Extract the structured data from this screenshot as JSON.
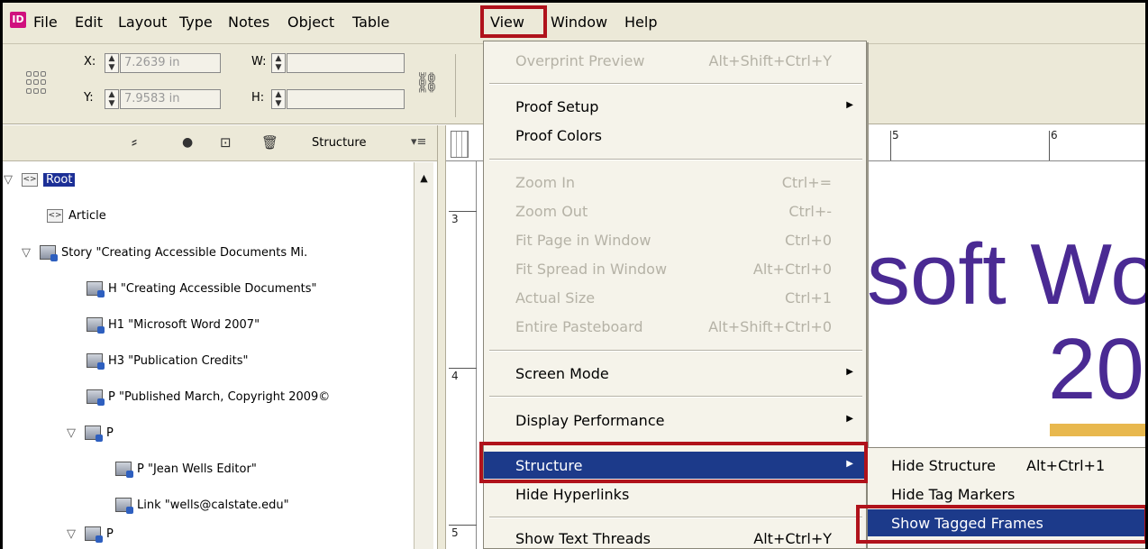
{
  "menubar": {
    "app_icon": "ID",
    "items": [
      "File",
      "Edit",
      "Layout",
      "Type",
      "Notes",
      "Object",
      "Table",
      "View",
      "Window",
      "Help"
    ]
  },
  "control": {
    "x_label": "X:",
    "x_value": "7.2639 in",
    "y_label": "Y:",
    "y_value": "7.9583 in",
    "w_label": "W:",
    "h_label": "H:"
  },
  "structure_panel": {
    "title": "Structure",
    "rows": [
      {
        "text": "Root"
      },
      {
        "text": "Article"
      },
      {
        "text": "Story   \"Creating Accessible Documents Mi."
      },
      {
        "text": "H   \"Creating Accessible Documents\""
      },
      {
        "text": "H1   \"Microsoft Word 2007\""
      },
      {
        "text": "H3   \"Publication Credits\""
      },
      {
        "text": "P   \"Published March, Copyright 2009©"
      },
      {
        "text": "P"
      },
      {
        "text": "P   \"Jean Wells Editor\""
      },
      {
        "text": "Link   \"wells@calstate.edu\""
      },
      {
        "text": "P"
      }
    ]
  },
  "rulers": {
    "h_nums": [
      "5",
      "6"
    ],
    "v_nums": [
      "3",
      "4",
      "5"
    ]
  },
  "document": {
    "line1": "soft Wo",
    "line2": "20"
  },
  "view_menu": {
    "overprint": {
      "label": "Overprint Preview",
      "shortcut": "Alt+Shift+Ctrl+Y"
    },
    "proof_setup": "Proof Setup",
    "proof_colors": "Proof Colors",
    "zoom_in": {
      "label": "Zoom In",
      "shortcut": "Ctrl+="
    },
    "zoom_out": {
      "label": "Zoom Out",
      "shortcut": "Ctrl+-"
    },
    "fit_page": {
      "label": "Fit Page in Window",
      "shortcut": "Ctrl+0"
    },
    "fit_spread": {
      "label": "Fit Spread in Window",
      "shortcut": "Alt+Ctrl+0"
    },
    "actual_size": {
      "label": "Actual Size",
      "shortcut": "Ctrl+1"
    },
    "entire_pasteboard": {
      "label": "Entire Pasteboard",
      "shortcut": "Alt+Shift+Ctrl+0"
    },
    "screen_mode": "Screen Mode",
    "display_performance": "Display Performance",
    "structure": "Structure",
    "hide_hyperlinks": "Hide Hyperlinks",
    "show_text_threads": {
      "label": "Show Text Threads",
      "shortcut": "Alt+Ctrl+Y"
    }
  },
  "structure_submenu": {
    "hide_structure": {
      "label": "Hide Structure",
      "shortcut": "Alt+Ctrl+1"
    },
    "hide_tag_markers": "Hide Tag Markers",
    "show_tagged_frames": "Show Tagged Frames"
  },
  "colors": {
    "highlight": "#1c3a8a",
    "callout_red": "#b0121b",
    "doc_purple": "#4a2a93",
    "doc_gold": "#e8b84e"
  }
}
